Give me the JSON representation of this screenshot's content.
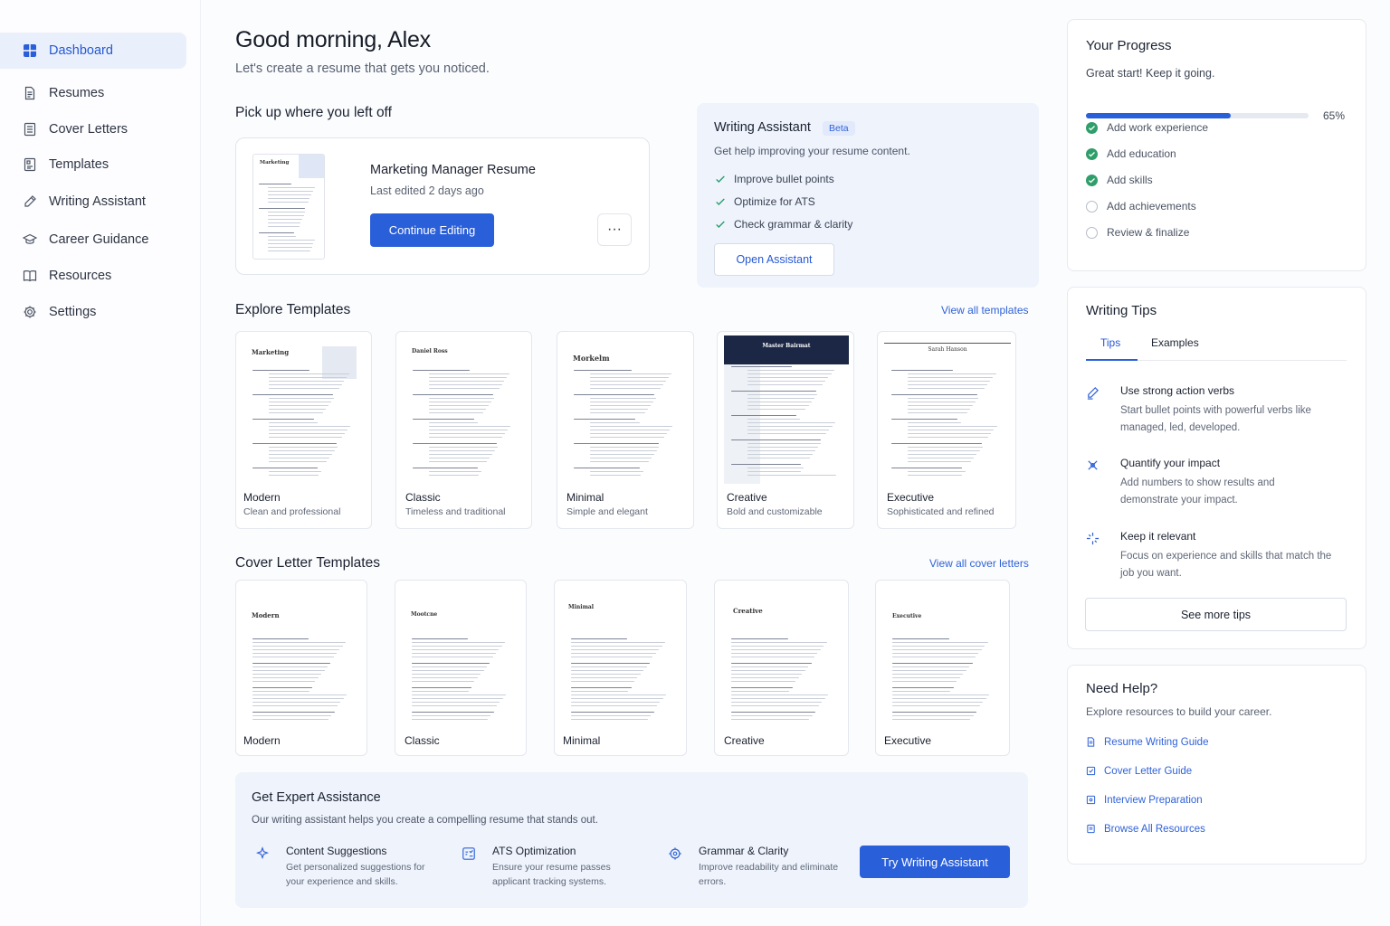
{
  "sidebar": {
    "items": [
      {
        "label": "Dashboard",
        "icon": "dashboard-icon"
      },
      {
        "label": "Resumes",
        "icon": "document-icon"
      },
      {
        "label": "Cover Letters",
        "icon": "letter-icon"
      },
      {
        "label": "Templates",
        "icon": "template-icon"
      },
      {
        "label": "Writing Assistant",
        "icon": "pen-icon"
      },
      {
        "label": "Career Guidance",
        "icon": "graduation-cap-icon"
      },
      {
        "label": "Resources",
        "icon": "book-icon"
      },
      {
        "label": "Settings",
        "icon": "gear-icon"
      }
    ],
    "active": "Dashboard"
  },
  "header": {
    "greeting": "Good morning, Alex",
    "subtitle": "Let's create a resume that gets you noticed."
  },
  "continue_section": {
    "title": "Pick up where you left off",
    "resume_title": "Marketing Manager Resume",
    "last_edited": "Last edited 2 days ago",
    "continue_label": "Continue Editing",
    "more_label": "···",
    "thumb_heading": "Marketing"
  },
  "writing_assistant": {
    "title": "Writing Assistant",
    "badge": "Beta",
    "subtitle": "Get help improving your resume content.",
    "items": [
      "Improve bullet points",
      "Optimize for ATS",
      "Check grammar & clarity"
    ],
    "button_label": "Open Assistant"
  },
  "templates": {
    "title": "Explore Templates",
    "view_all": "View all templates",
    "items": [
      {
        "name": "Modern",
        "desc": "Clean and professional",
        "heading": "Marketing"
      },
      {
        "name": "Classic",
        "desc": "Timeless and traditional",
        "heading": "Daniel Ross"
      },
      {
        "name": "Minimal",
        "desc": "Simple and elegant",
        "heading": "Morkelm"
      },
      {
        "name": "Creative",
        "desc": "Bold and customizable",
        "heading": "Master Bairmat"
      },
      {
        "name": "Executive",
        "desc": "Sophisticated and refined",
        "heading": "Sarah Hanson"
      }
    ]
  },
  "cover_letters": {
    "title": "Cover Letter Templates",
    "view_all": "View all cover letters",
    "items": [
      {
        "name": "Modern",
        "heading": "Modern"
      },
      {
        "name": "Classic",
        "heading": "Mootcne"
      },
      {
        "name": "Minimal",
        "heading": "Minimal"
      },
      {
        "name": "Creative",
        "heading": "Creative"
      },
      {
        "name": "Executive",
        "heading": "Executive"
      }
    ]
  },
  "expert": {
    "title": "Get Expert Assistance",
    "subtitle": "Our writing assistant helps you create a compelling resume that stands out.",
    "features": [
      {
        "title": "Content Suggestions",
        "desc": "Get personalized suggestions for your experience and skills.",
        "icon": "sparkle-icon"
      },
      {
        "title": "ATS Optimization",
        "desc": "Ensure your resume passes applicant tracking systems.",
        "icon": "ats-icon"
      },
      {
        "title": "Grammar & Clarity",
        "desc": "Improve readability and eliminate errors.",
        "icon": "gear-check-icon"
      }
    ],
    "button_label": "Try Writing Assistant"
  },
  "progress": {
    "title": "Your Progress",
    "subtitle": "Great start! Keep it going.",
    "percent": 65,
    "percent_label": "65%",
    "tasks": [
      {
        "label": "Add work experience",
        "done": true
      },
      {
        "label": "Add education",
        "done": true
      },
      {
        "label": "Add skills",
        "done": true
      },
      {
        "label": "Add achievements",
        "done": false
      },
      {
        "label": "Review & finalize",
        "done": false
      }
    ]
  },
  "writing_tips": {
    "title": "Writing Tips",
    "tabs": [
      "Tips",
      "Examples"
    ],
    "active_tab": "Tips",
    "tips": [
      {
        "title": "Use strong action verbs",
        "desc": "Start bullet points with powerful verbs like managed, led, developed.",
        "icon": "pen-icon"
      },
      {
        "title": "Quantify your impact",
        "desc": "Add numbers to show results and demonstrate your impact.",
        "icon": "target-icon"
      },
      {
        "title": "Keep it relevant",
        "desc": "Focus on experience and skills that match the job you want.",
        "icon": "sparkle-icon"
      }
    ],
    "button_label": "See more tips"
  },
  "help": {
    "title": "Need Help?",
    "subtitle": "Explore resources to build your career.",
    "links": [
      "Resume Writing Guide",
      "Cover Letter Guide",
      "Interview Preparation",
      "Browse All Resources"
    ]
  },
  "colors": {
    "accent": "#2a5fda",
    "success": "#2f9e6a",
    "panel_bg": "#eef3fc"
  }
}
